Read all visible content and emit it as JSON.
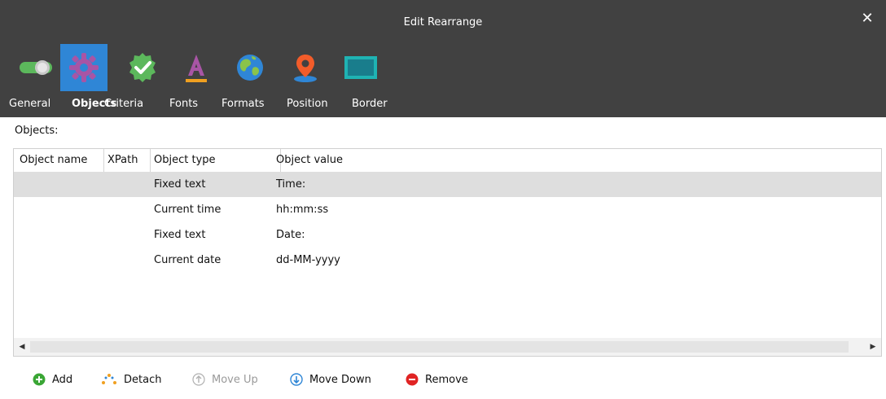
{
  "window": {
    "title": "Edit Rearrange"
  },
  "tabs": [
    {
      "label": "General",
      "icon": "toggle-icon"
    },
    {
      "label": "Objects",
      "icon": "gear-icon",
      "active": true
    },
    {
      "label": "Criteria",
      "icon": "check-badge-icon"
    },
    {
      "label": "Fonts",
      "icon": "font-a-icon"
    },
    {
      "label": "Formats",
      "icon": "globe-icon"
    },
    {
      "label": "Position",
      "icon": "map-pin-icon"
    },
    {
      "label": "Border",
      "icon": "border-rectangle-icon"
    }
  ],
  "objects": {
    "section_label": "Objects:",
    "columns": [
      "Object name",
      "XPath",
      "Object type",
      "Object value"
    ],
    "rows": [
      {
        "name": "",
        "xpath": "",
        "type": "Fixed text",
        "value": "Time:",
        "selected": true
      },
      {
        "name": "",
        "xpath": "",
        "type": "Current time",
        "value": "hh:mm:ss"
      },
      {
        "name": "",
        "xpath": "",
        "type": "Fixed text",
        "value": "Date:"
      },
      {
        "name": "",
        "xpath": "",
        "type": "Current date",
        "value": "dd-MM-yyyy"
      }
    ]
  },
  "toolbar": {
    "add_label": "Add",
    "detach_label": "Detach",
    "move_up_label": "Move Up",
    "move_down_label": "Move Down",
    "remove_label": "Remove"
  },
  "colors": {
    "titlebar_bg": "#414141",
    "active_tab_bg": "#2f86d6",
    "selected_row_bg": "#dedede",
    "add_green": "#3aa635",
    "remove_red": "#e02424",
    "move_down_blue": "#2f86d6"
  }
}
